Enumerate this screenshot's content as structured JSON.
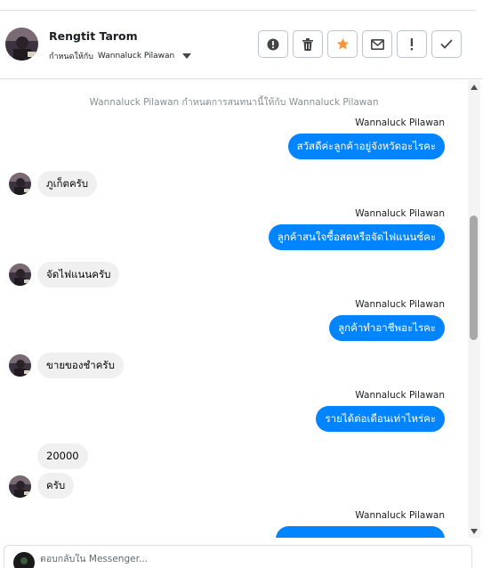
{
  "header": {
    "name": "Rengtit Tarom",
    "assign_label": "กำหนดให้กับ",
    "assignee": "Wannaluck Pilawan"
  },
  "actions": [
    {
      "icon": "alert-circle-icon"
    },
    {
      "icon": "trash-icon"
    },
    {
      "icon": "star-icon",
      "color": "#f7923a"
    },
    {
      "icon": "mail-icon"
    },
    {
      "icon": "exclamation-icon"
    },
    {
      "icon": "check-icon"
    }
  ],
  "chat": {
    "system_note": "Wannaluck Pilawan กำหนดการสนทนานี้ให้กับ Wannaluck Pilawan",
    "messages": [
      {
        "dir": "out",
        "sender": "Wannaluck Pilawan",
        "text": "สวัสดีค่ะลูกค้าอยู่จังหวัดอะไรคะ"
      },
      {
        "dir": "in",
        "text": "ภูเก็ตครับ"
      },
      {
        "dir": "out",
        "sender": "Wannaluck Pilawan",
        "text": "ลูกค้าสนใจซื้อสดหรือจัดไฟแนนซ์คะ"
      },
      {
        "dir": "in",
        "text": "จัดไฟแนนครับ"
      },
      {
        "dir": "out",
        "sender": "Wannaluck Pilawan",
        "text": "ลูกค้าทำอาชีพอะไรคะ"
      },
      {
        "dir": "in",
        "text": "ขายของชำครับ"
      },
      {
        "dir": "out",
        "sender": "Wannaluck Pilawan",
        "text": "รายได้ต่อเดือนเท่าไหร่คะ"
      },
      {
        "dir": "in",
        "text": "20000"
      },
      {
        "dir": "in",
        "text": "ครับ"
      },
      {
        "dir": "out",
        "sender": "Wannaluck Pilawan",
        "text": ""
      }
    ]
  },
  "composer": {
    "placeholder": "ตอบกลับใน Messenger..."
  },
  "colors": {
    "outgoing_bubble": "#0084ff",
    "incoming_bubble": "#f0f0f0"
  }
}
